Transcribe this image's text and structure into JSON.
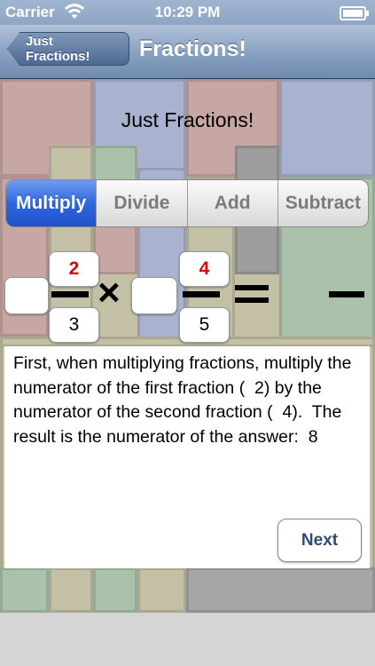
{
  "status_bar": {
    "carrier": "Carrier",
    "time": "10:29 PM"
  },
  "nav": {
    "back_label": "Just Fractions!",
    "title": "Fractions!"
  },
  "heading": "Just Fractions!",
  "operations": [
    "Multiply",
    "Divide",
    "Add",
    "Subtract"
  ],
  "selected_operation": "Multiply",
  "equation": {
    "first": {
      "whole": "",
      "numerator": "2",
      "denominator": "3"
    },
    "operator": "×",
    "second": {
      "whole": "",
      "numerator": "4",
      "denominator": "5"
    },
    "equals": "="
  },
  "explanation": "First, when multiplying fractions, multiply the numerator of the first fraction (  2) by the numerator of the second fraction (  4).  The result is the numerator of the answer:  8",
  "next_label": "Next",
  "colors": {
    "selected_segment": "#2f66df",
    "highlight_number": "#e10000"
  }
}
